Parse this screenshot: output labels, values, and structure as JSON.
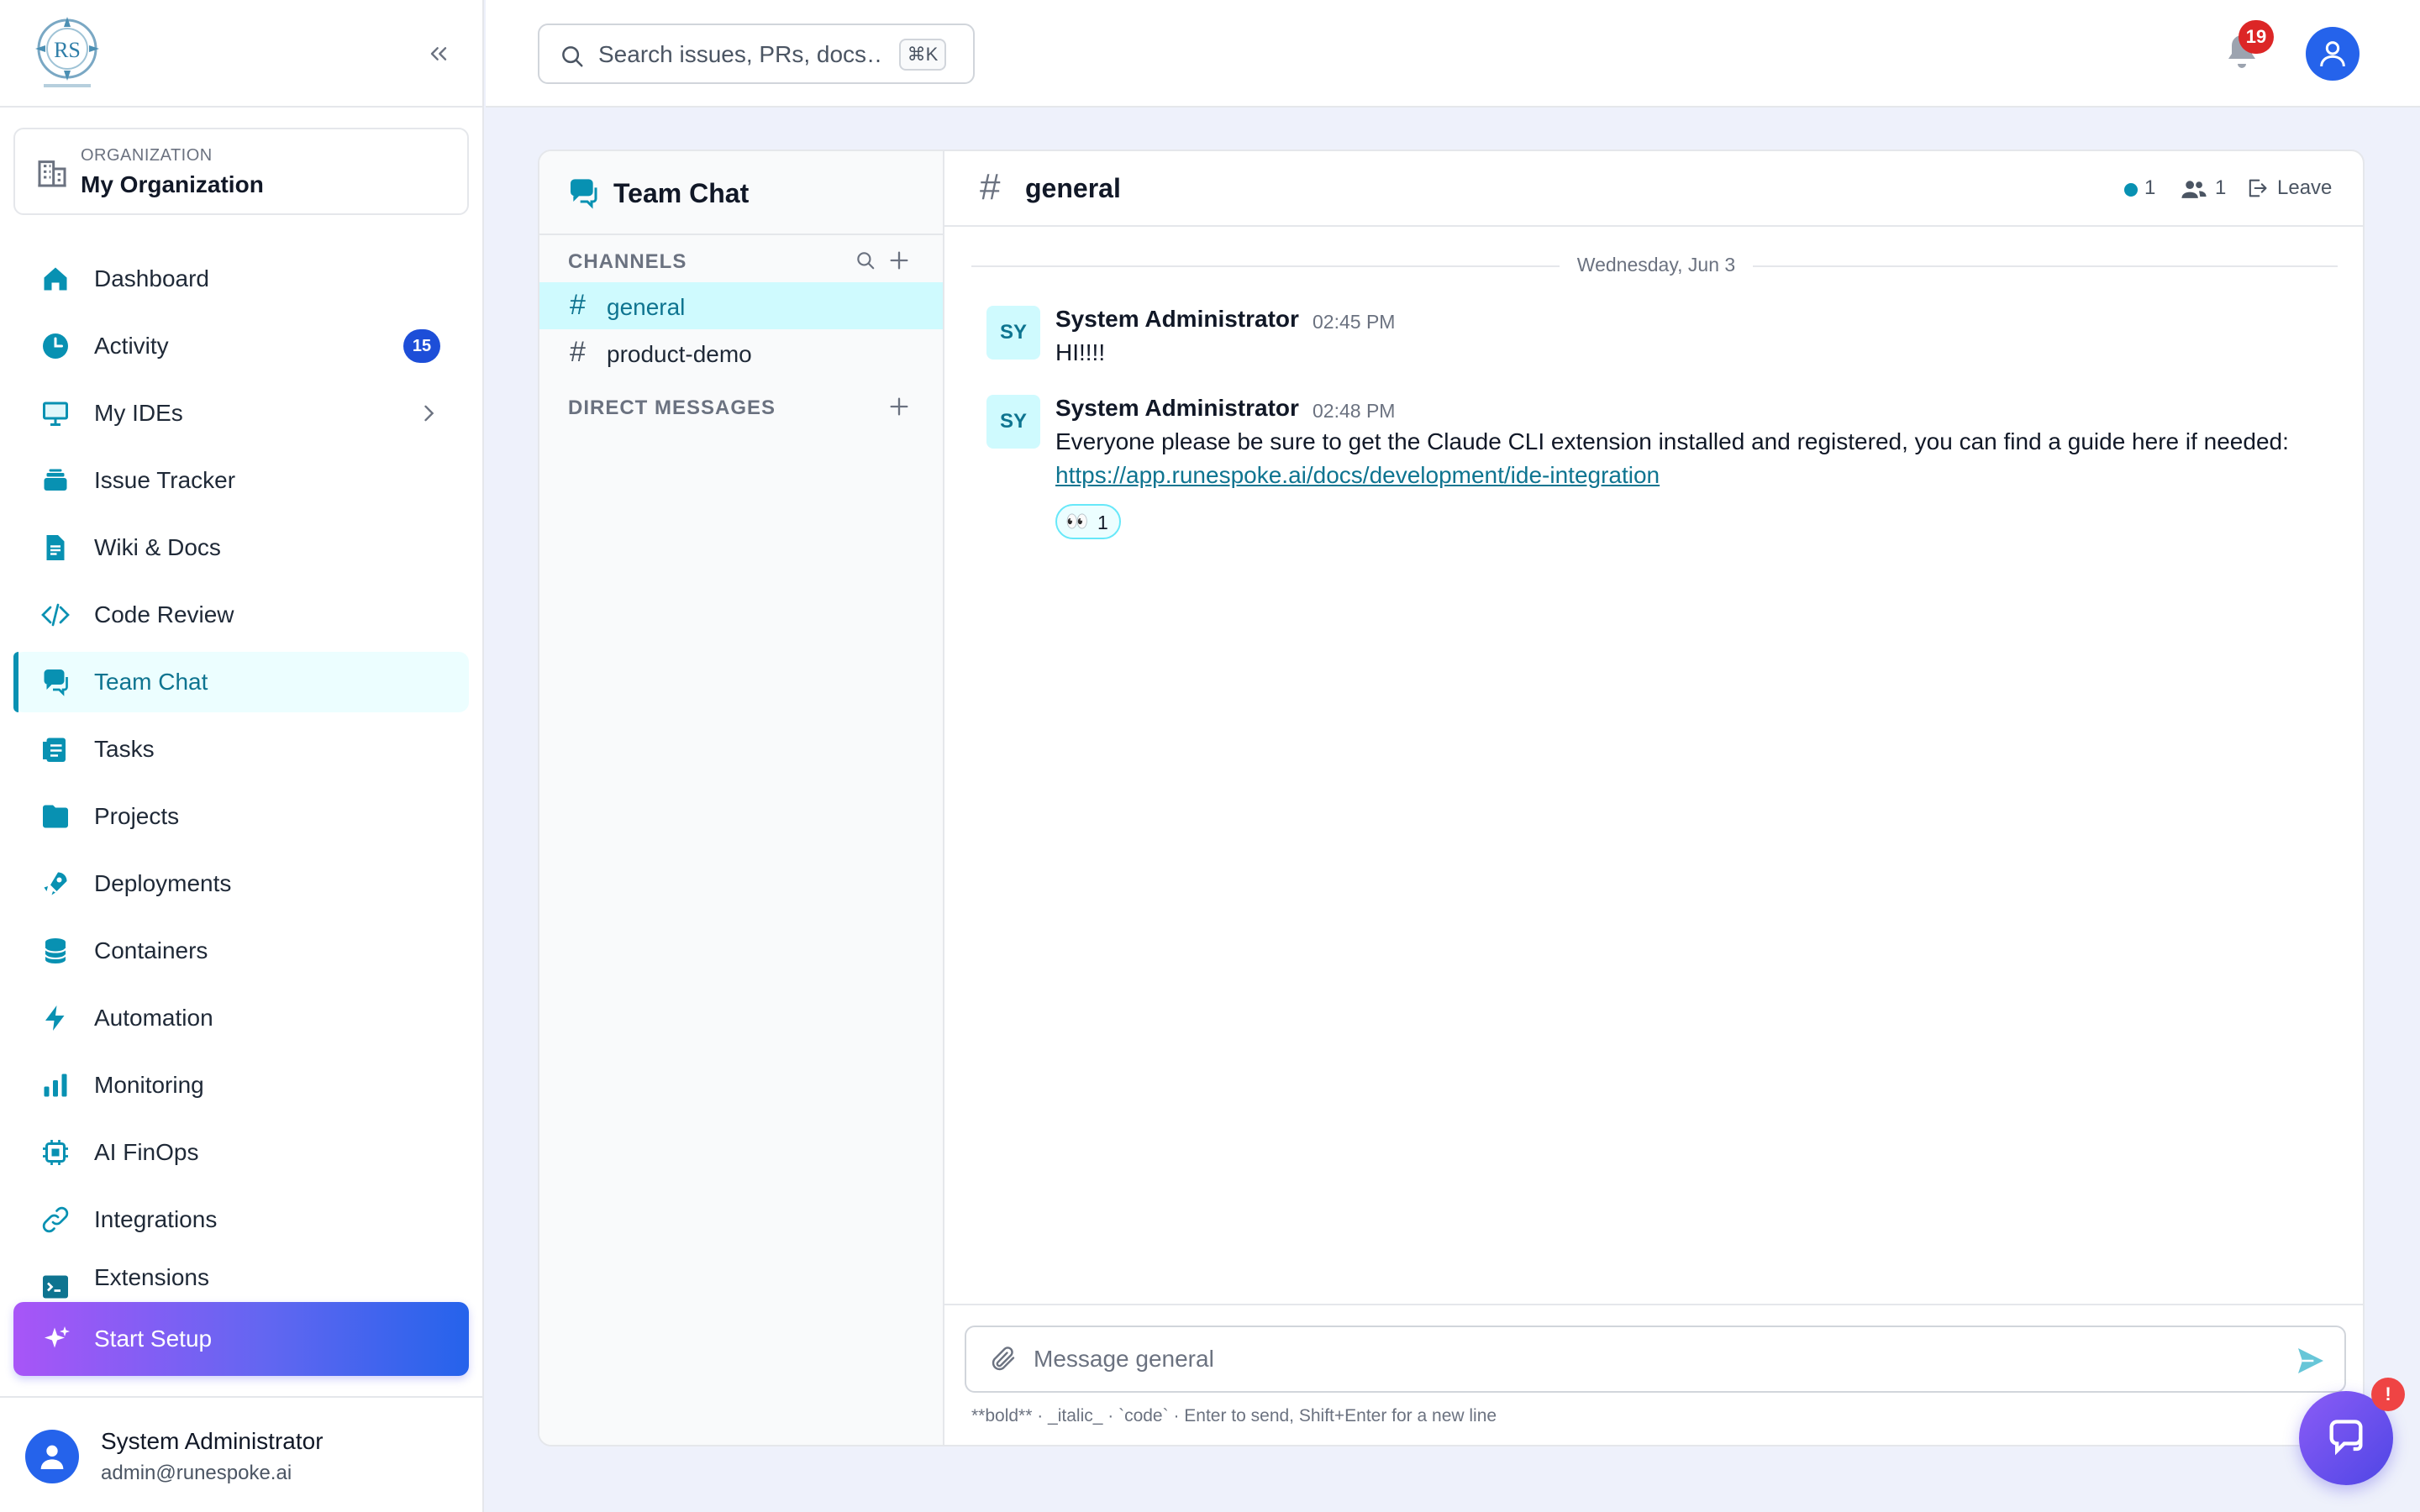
{
  "colors": {
    "accent": "#0891b2",
    "accent_dark": "#0e7490",
    "active_bg": "#ecfeff",
    "primary_blue": "#2563eb",
    "badge_red": "#dc2626",
    "setup_gradient_start": "#a855f7",
    "setup_gradient_end": "#2563eb"
  },
  "sidebar": {
    "logo_icon": "runespoke-logo",
    "collapse_icon": "chevrons-left-icon",
    "organization": {
      "label": "ORGANIZATION",
      "name": "My Organization",
      "icon": "building-icon"
    },
    "nav": [
      {
        "label": "Dashboard",
        "icon": "home-icon"
      },
      {
        "label": "Activity",
        "icon": "clock-icon",
        "badge": "15"
      },
      {
        "label": "My IDEs",
        "icon": "monitor-icon"
      },
      {
        "label": "Issue Tracker",
        "icon": "inbox-stack-icon"
      },
      {
        "label": "Wiki & Docs",
        "icon": "document-icon"
      },
      {
        "label": "Code Review",
        "icon": "code-icon"
      },
      {
        "label": "Team Chat",
        "icon": "chat-bubbles-icon",
        "active": true
      },
      {
        "label": "Tasks",
        "icon": "clipboard-list-icon"
      },
      {
        "label": "Projects",
        "icon": "folder-icon"
      },
      {
        "label": "Deployments",
        "icon": "rocket-icon"
      },
      {
        "label": "Containers",
        "icon": "database-icon"
      },
      {
        "label": "Automation",
        "icon": "bolt-icon"
      },
      {
        "label": "Monitoring",
        "icon": "bar-chart-icon"
      },
      {
        "label": "AI FinOps",
        "icon": "cpu-chip-icon"
      },
      {
        "label": "Integrations",
        "icon": "link-icon"
      },
      {
        "label": "Extensions",
        "icon": "terminal-icon"
      }
    ],
    "setup": {
      "label": "Start Setup",
      "icon": "sparkles-icon"
    },
    "user": {
      "name": "System Administrator",
      "email": "admin@runespoke.ai"
    }
  },
  "topbar": {
    "search": {
      "placeholder": "Search issues, PRs, docs…",
      "shortcut": "⌘K"
    },
    "notifications": {
      "count": "19"
    }
  },
  "chat": {
    "title": "Team Chat",
    "channels_label": "CHANNELS",
    "channels": [
      {
        "name": "general",
        "selected": true
      },
      {
        "name": "product-demo",
        "selected": false
      }
    ],
    "dm_label": "DIRECT MESSAGES",
    "conversation": {
      "channel": "general",
      "online_count": "1",
      "member_count": "1",
      "leave_label": "Leave",
      "date_separator": "Wednesday, Jun 3",
      "messages": [
        {
          "initials": "SY",
          "author": "System Administrator",
          "time": "02:45 PM",
          "text": "HI!!!!"
        },
        {
          "initials": "SY",
          "author": "System Administrator",
          "time": "02:48 PM",
          "text": "Everyone please be sure to get the Claude CLI extension installed and registered, you can find a guide here if needed:",
          "link": "https://app.runespoke.ai/docs/development/ide-integration",
          "reaction": {
            "emoji": "👀",
            "count": "1"
          }
        }
      ]
    },
    "composer": {
      "placeholder": "Message general",
      "hint": "**bold** · _italic_ · `code` · Enter to send, Shift+Enter for a new line"
    }
  },
  "support": {
    "badge": "!"
  }
}
